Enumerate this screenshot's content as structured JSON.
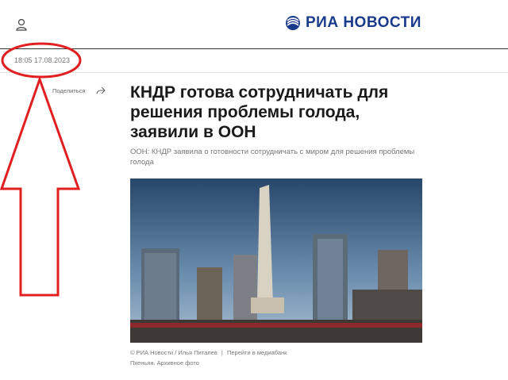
{
  "header": {
    "logo_text": "РИА НОВОСТИ",
    "user_icon": "user-icon",
    "logo_icon": "ria-logo-icon"
  },
  "article": {
    "datetime": "18:05 17.08.2023",
    "share_label": "Поделиться",
    "share_icon": "share-arrow-icon",
    "headline": "КНДР готова сотрудничать для решения проблемы голода, заявили в ООН",
    "lead": "ООН: КНДР заявила о готовности сотрудничать с миром для решения проблемы голода",
    "caption": {
      "credit": "© РИА Новости / Илья Питалев",
      "mediabank_link": "Перейти в медиабанк",
      "description": "Пхеньян. Архивное фото"
    }
  },
  "colors": {
    "brand": "#1a3a8c",
    "annotation_red": "#e02020"
  }
}
